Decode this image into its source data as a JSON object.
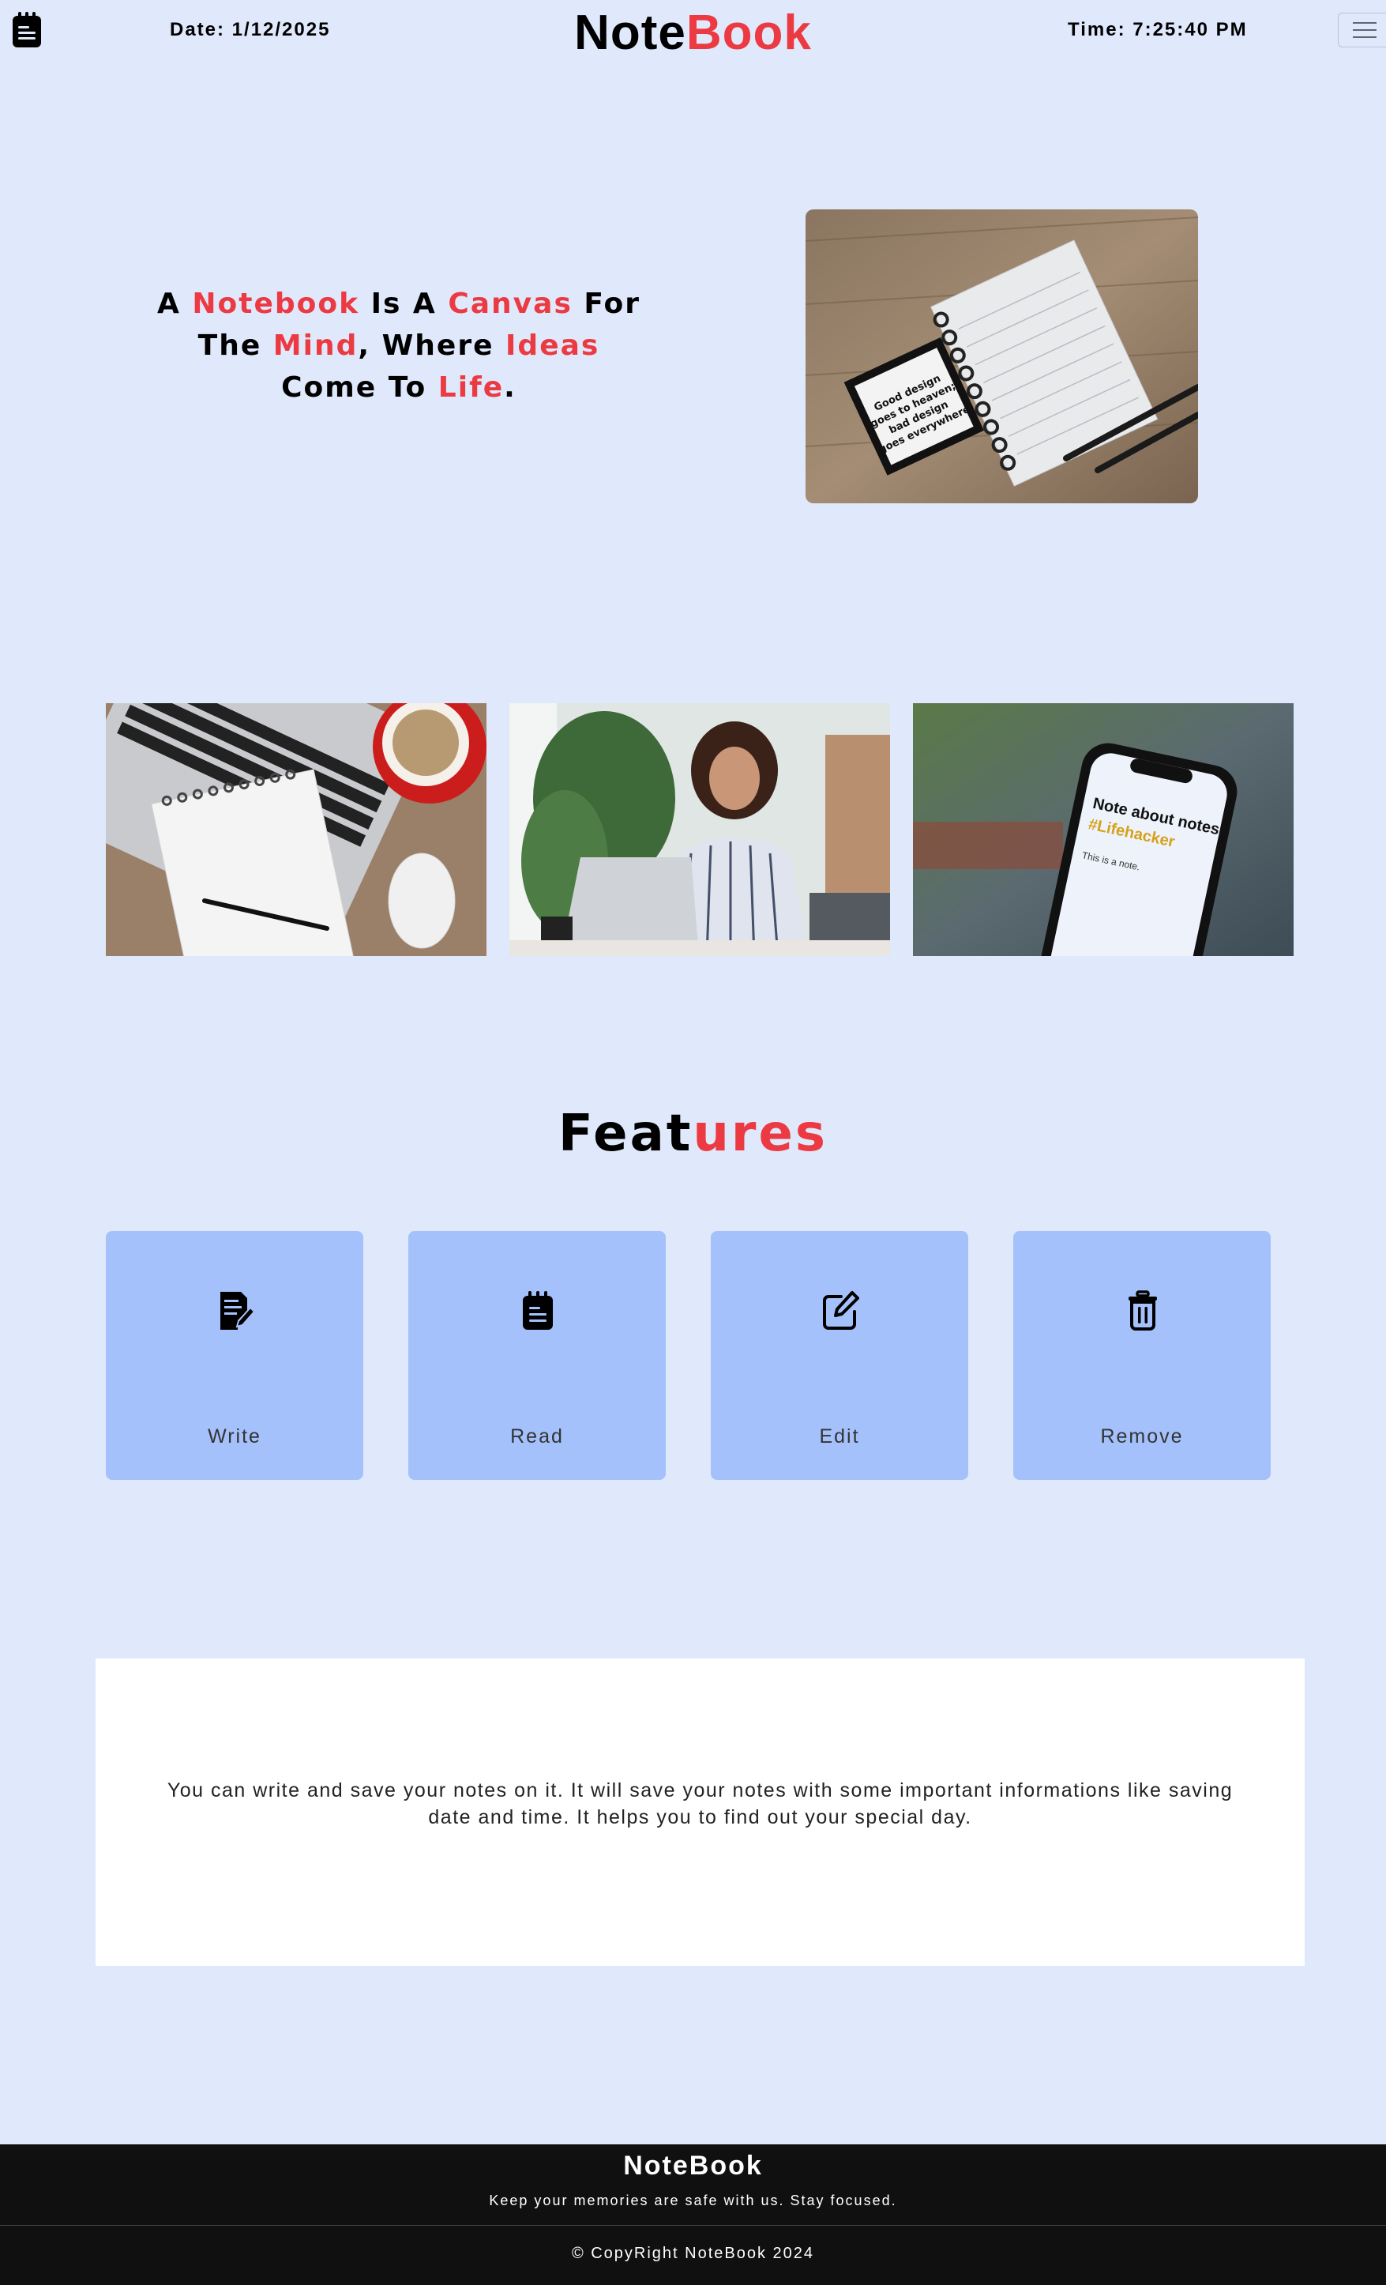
{
  "header": {
    "logo_icon": "notepad-icon",
    "date_text": "Date: 1/12/2025",
    "brand_part1": "Note",
    "brand_part2": "Book",
    "time_text": "Time: 7:25:40 PM",
    "menu_icon": "hamburger-icon"
  },
  "hero": {
    "headline": [
      {
        "text": "A ",
        "accent": false
      },
      {
        "text": "Notebook",
        "accent": true
      },
      {
        "text": " Is A ",
        "accent": false
      },
      {
        "text": "Canvas",
        "accent": true
      },
      {
        "text": " For The ",
        "accent": false
      },
      {
        "text": "Mind",
        "accent": true
      },
      {
        "text": ", Where ",
        "accent": false
      },
      {
        "text": "Ideas",
        "accent": true
      },
      {
        "text": " Come To ",
        "accent": false
      },
      {
        "text": "Life",
        "accent": true
      },
      {
        "text": ".",
        "accent": false
      }
    ],
    "image": {
      "name": "notebook-photo",
      "card_text": "Good design goes to heaven; bad design goes everywhere"
    }
  },
  "gallery": [
    {
      "name": "laptop-notepad-coffee-photo"
    },
    {
      "name": "woman-at-laptop-photo"
    },
    {
      "name": "phone-notes-app-photo",
      "screen_title": "Note about notes",
      "screen_tag": "#Lifehacker"
    }
  ],
  "features": {
    "title_part1": "Feat",
    "title_part2": "ures",
    "cards": [
      {
        "label": "Write",
        "icon": "write-note-icon"
      },
      {
        "label": "Read",
        "icon": "notepad-icon"
      },
      {
        "label": "Edit",
        "icon": "edit-icon"
      },
      {
        "label": "Remove",
        "icon": "trash-icon"
      }
    ]
  },
  "info": {
    "text": "You can write and save your notes on it. It will save your notes with some important informations like saving date and time. It helps you to find out your special day."
  },
  "footer": {
    "brand": "NoteBook",
    "tagline": "Keep your memories are safe with us. Stay focused.",
    "copyright": "© CopyRight NoteBook 2024"
  },
  "colors": {
    "background": "#e0e8fb",
    "accent": "#ec3a42",
    "card": "#a4c1fb",
    "footer": "#101010"
  }
}
